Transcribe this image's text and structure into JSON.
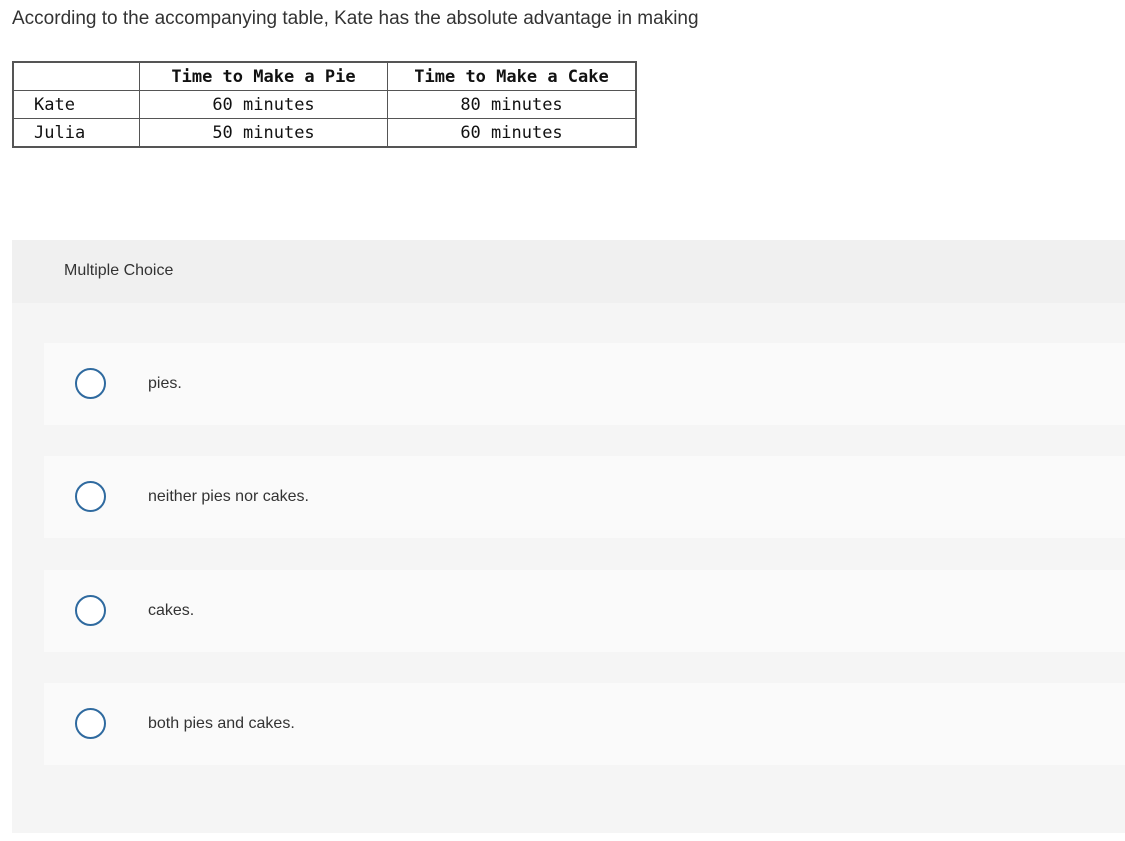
{
  "question": {
    "text": "According to the accompanying table, Kate has the absolute advantage in making"
  },
  "table": {
    "headers": [
      "",
      "Time to Make a Pie",
      "Time to Make a Cake"
    ],
    "rows": [
      {
        "name": "Kate",
        "pie": "60 minutes",
        "cake": "80 minutes"
      },
      {
        "name": "Julia",
        "pie": "50 minutes",
        "cake": "60 minutes"
      }
    ]
  },
  "multiple_choice": {
    "header_label": "Multiple Choice",
    "options": [
      {
        "label": "pies."
      },
      {
        "label": "neither pies nor cakes."
      },
      {
        "label": "cakes."
      },
      {
        "label": "both pies and cakes."
      }
    ]
  },
  "colors": {
    "radio_border": "#2f6a9f",
    "panel_background": "#f5f5f5",
    "option_background": "#fafafa"
  }
}
